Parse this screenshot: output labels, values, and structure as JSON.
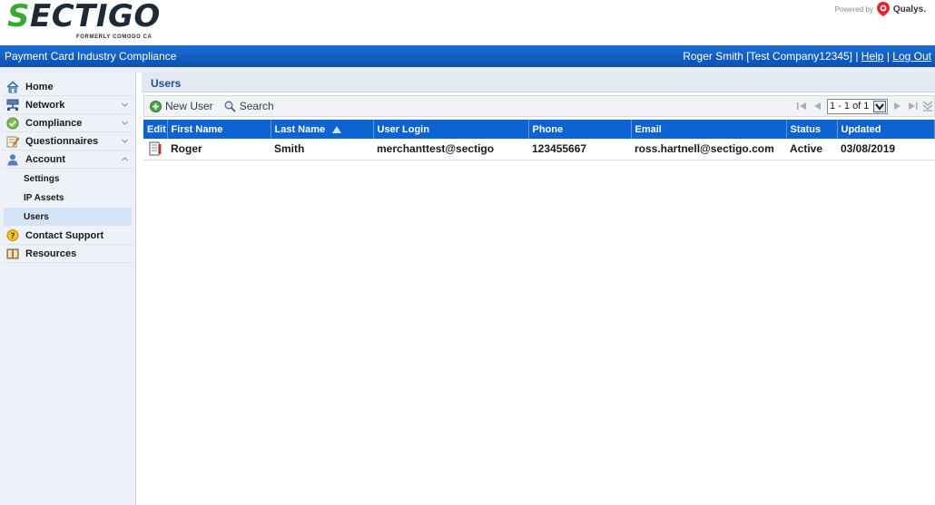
{
  "header": {
    "logo_text_lead": "S",
    "logo_text_rest": "ECTIGO",
    "logo_subtitle": "FORMERLY COMODO CA",
    "powered_by": "Powered by",
    "partner_name": "Qualys.",
    "app_title": "Payment Card Industry Compliance",
    "user_name": "Roger Smith [Test Company12345]",
    "separator": "|",
    "help_link": "Help",
    "logout_link": "Log Out"
  },
  "sidebar": {
    "items": [
      {
        "label": "Home",
        "icon": "home-icon"
      },
      {
        "label": "Network",
        "icon": "network-icon"
      },
      {
        "label": "Compliance",
        "icon": "compliance-check-icon"
      },
      {
        "label": "Questionnaires",
        "icon": "questionnaire-pencil-icon"
      },
      {
        "label": "Account",
        "icon": "user-account-icon"
      }
    ],
    "account_sub_items": [
      {
        "label": "Settings"
      },
      {
        "label": "IP Assets"
      },
      {
        "label": "Users",
        "selected": true
      }
    ],
    "bottom_items": [
      {
        "label": "Contact Support",
        "icon": "support-bubble-icon"
      },
      {
        "label": "Resources",
        "icon": "book-icon"
      }
    ]
  },
  "main": {
    "panel_title": "Users",
    "toolbar": {
      "new_user_label": "New User",
      "search_label": "Search"
    },
    "pager": {
      "range_text": "1 - 1 of 1"
    },
    "table": {
      "columns": [
        "Edit",
        "First Name",
        "Last Name",
        "User Login",
        "Phone",
        "Email",
        "Status",
        "Updated"
      ],
      "sorted_column": "Last Name",
      "rows": [
        {
          "first_name": "Roger",
          "last_name": "Smith",
          "user_login": "merchanttest@sectigo",
          "phone": "123455667",
          "email": "ross.hartnell@sectigo.com",
          "status": "Active",
          "updated": "03/08/2019"
        }
      ]
    }
  },
  "colors": {
    "brand_green": "#39a935",
    "header_blue": "#0b4fae",
    "grid_header_blue": "#0d63cf",
    "panel_title_text": "#1f4f8f"
  }
}
